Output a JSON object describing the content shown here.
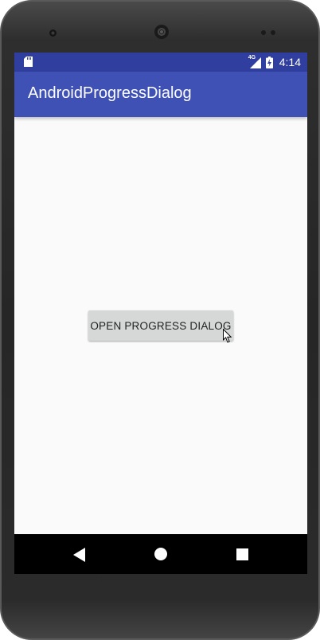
{
  "status_bar": {
    "network_type": "4G",
    "time": "4:14"
  },
  "app_bar": {
    "title": "AndroidProgressDialog"
  },
  "main": {
    "open_button_label": "OPEN PROGRESS DIALOG"
  },
  "colors": {
    "status_bar": "#303f9f",
    "app_bar": "#3f51b5",
    "background": "#fafafa",
    "button": "#d6d7d7"
  },
  "icons": {
    "status": [
      "sd-card-icon",
      "signal-icon",
      "battery-charging-icon"
    ],
    "nav": [
      "back-icon",
      "home-icon",
      "recents-icon"
    ]
  }
}
